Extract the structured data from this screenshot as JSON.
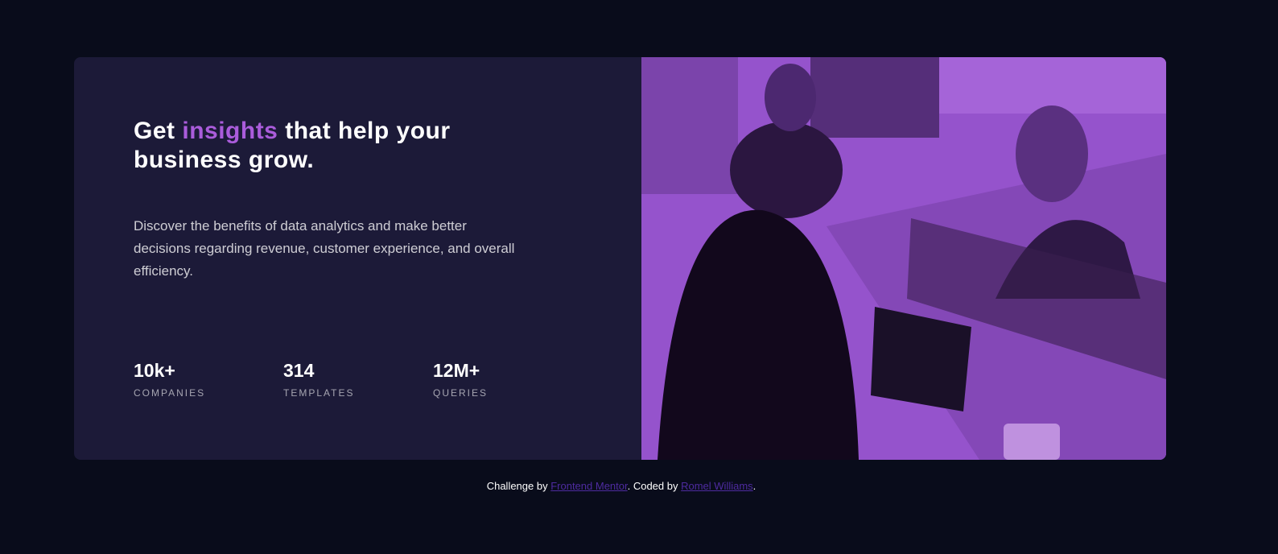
{
  "card": {
    "heading_before": "Get",
    "heading_accent": "insights",
    "heading_after": "that help your business grow.",
    "description": "Discover the benefits of data analytics and make better decisions regarding revenue, customer experience, and overall efficiency.",
    "stats": [
      {
        "value": "10k+",
        "label": "COMPANIES"
      },
      {
        "value": "314",
        "label": "TEMPLATES"
      },
      {
        "value": "12M+",
        "label": "QUERIES"
      }
    ]
  },
  "image": {
    "description_alt": "People working at desks with laptops"
  },
  "footer": {
    "text1": "Challenge by",
    "link1": "Frontend Mentor",
    "text2": ". Coded by",
    "link2": "Romel Williams",
    "text3": "."
  },
  "colors": {
    "background": "#090c1b",
    "card": "#1c1a38",
    "accent": "#aa5cdb",
    "link": "#4e2ba0"
  }
}
